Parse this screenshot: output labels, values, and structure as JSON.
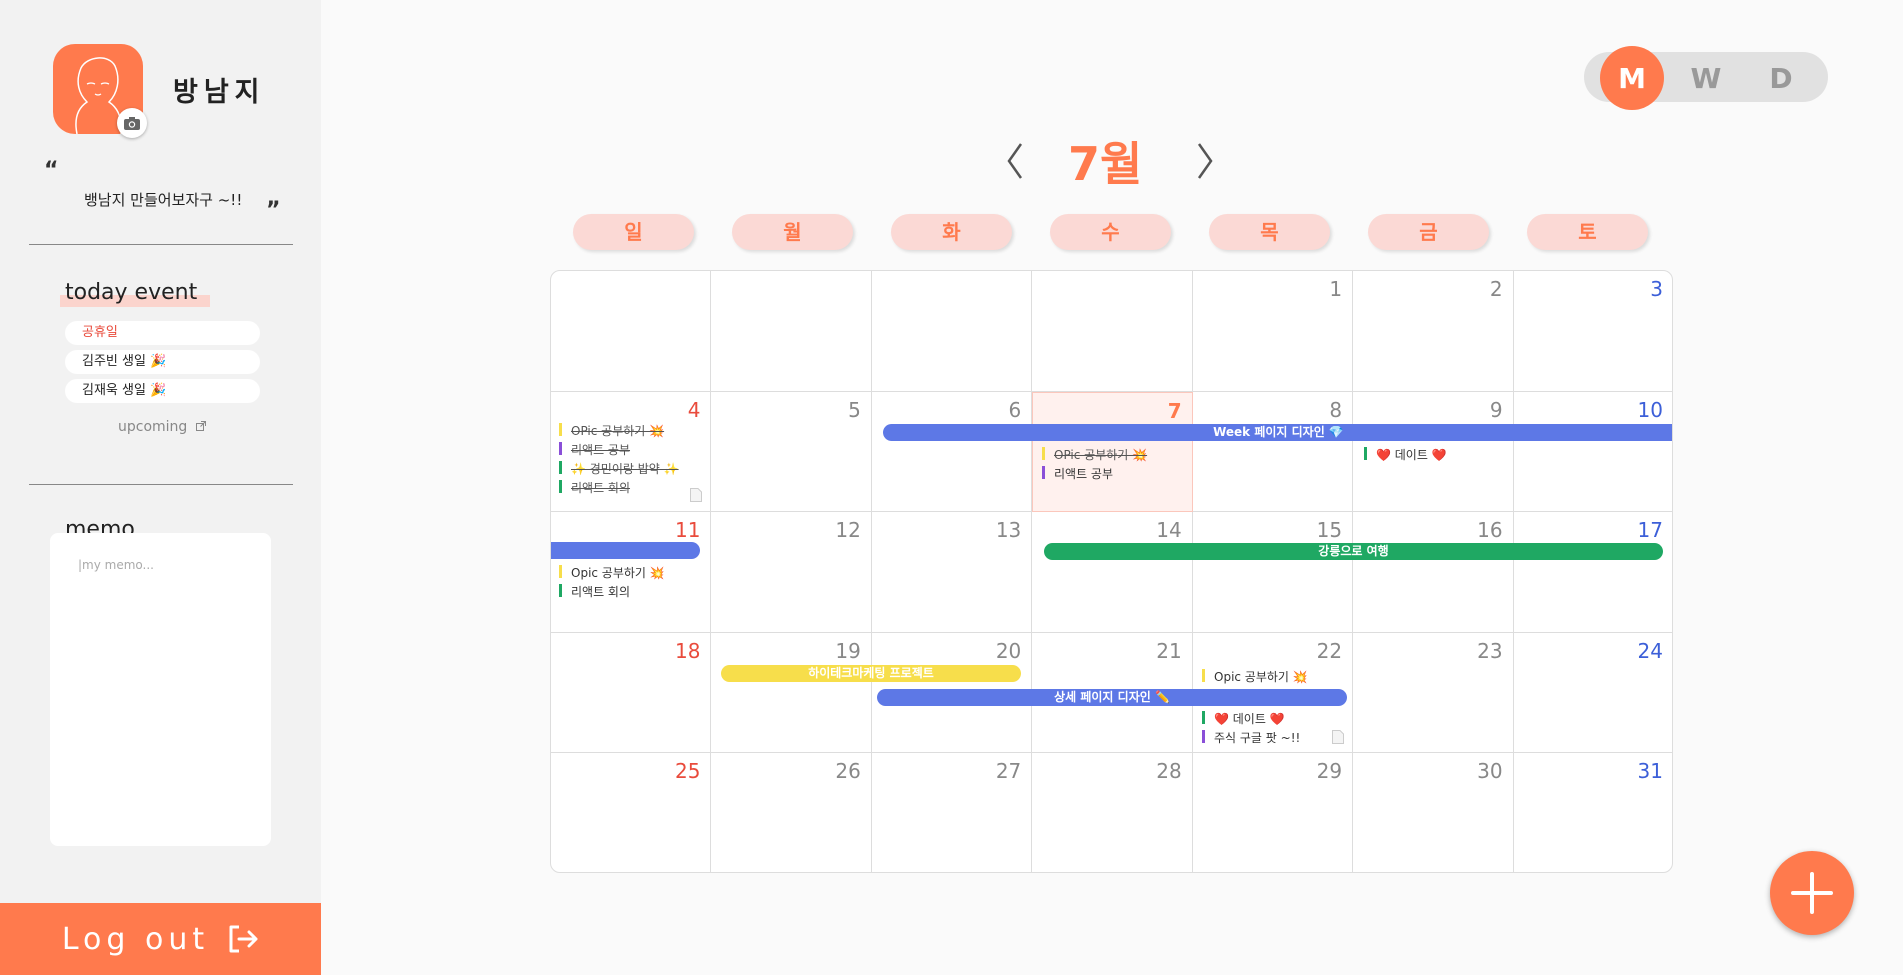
{
  "profile": {
    "name": "방남지",
    "status": "뱅남지 만들어보자구 ~!!",
    "quote_open": "“",
    "quote_close": "”"
  },
  "today_event": {
    "title": "today event",
    "items": [
      "공휴일",
      "김주빈 생일 🎉",
      "김재욱 생일 🎉"
    ],
    "upcoming_label": "upcoming"
  },
  "memo": {
    "title": "memo",
    "placeholder": "|my memo..."
  },
  "logout_label": "Log out",
  "view_toggle": [
    "M",
    "W",
    "D"
  ],
  "calendar": {
    "month": "7월",
    "weekdays": [
      "일",
      "월",
      "화",
      "수",
      "목",
      "금",
      "토"
    ],
    "weeks": [
      [
        "",
        "",
        "",
        "",
        "1",
        "2",
        "3"
      ],
      [
        "4",
        "5",
        "6",
        "7",
        "8",
        "9",
        "10"
      ],
      [
        "11",
        "12",
        "13",
        "14",
        "15",
        "16",
        "17"
      ],
      [
        "18",
        "19",
        "20",
        "21",
        "22",
        "23",
        "24"
      ],
      [
        "25",
        "26",
        "27",
        "28",
        "29",
        "30",
        "31"
      ]
    ],
    "events": {
      "week_page_design": "Week 페이지 디자인 💎",
      "gangneung_trip": "강릉으로 여행",
      "hitech_marketing": "하이테크마케팅 프로젝트",
      "detail_page_design": "상세 페이지 디자인 ✏️"
    },
    "todos": {
      "d4": [
        "OPic 공부하기 💥",
        "리액트 공부",
        "✨ 경민이랑 밥약 ✨",
        "리액트 회의"
      ],
      "d7": [
        "OPic 공부하기 💥",
        "리액트 공부"
      ],
      "d9": [
        "❤️ 데이트 ❤️"
      ],
      "d11": [
        "Opic 공부하기 💥",
        "리액트 회의"
      ],
      "d22": [
        "Opic 공부하기 💥",
        "❤️ 데이트 ❤️",
        "주식 구글 팟 ~!!"
      ]
    },
    "colors": {
      "yellow": "#f7de4b",
      "purple": "#8a4fd8",
      "green": "#1fa863",
      "blue": "#5d78e6"
    }
  },
  "theme": {
    "accent": "#ff7a4d",
    "sunday": "#e94b3c",
    "saturday": "#3c5fd8"
  }
}
